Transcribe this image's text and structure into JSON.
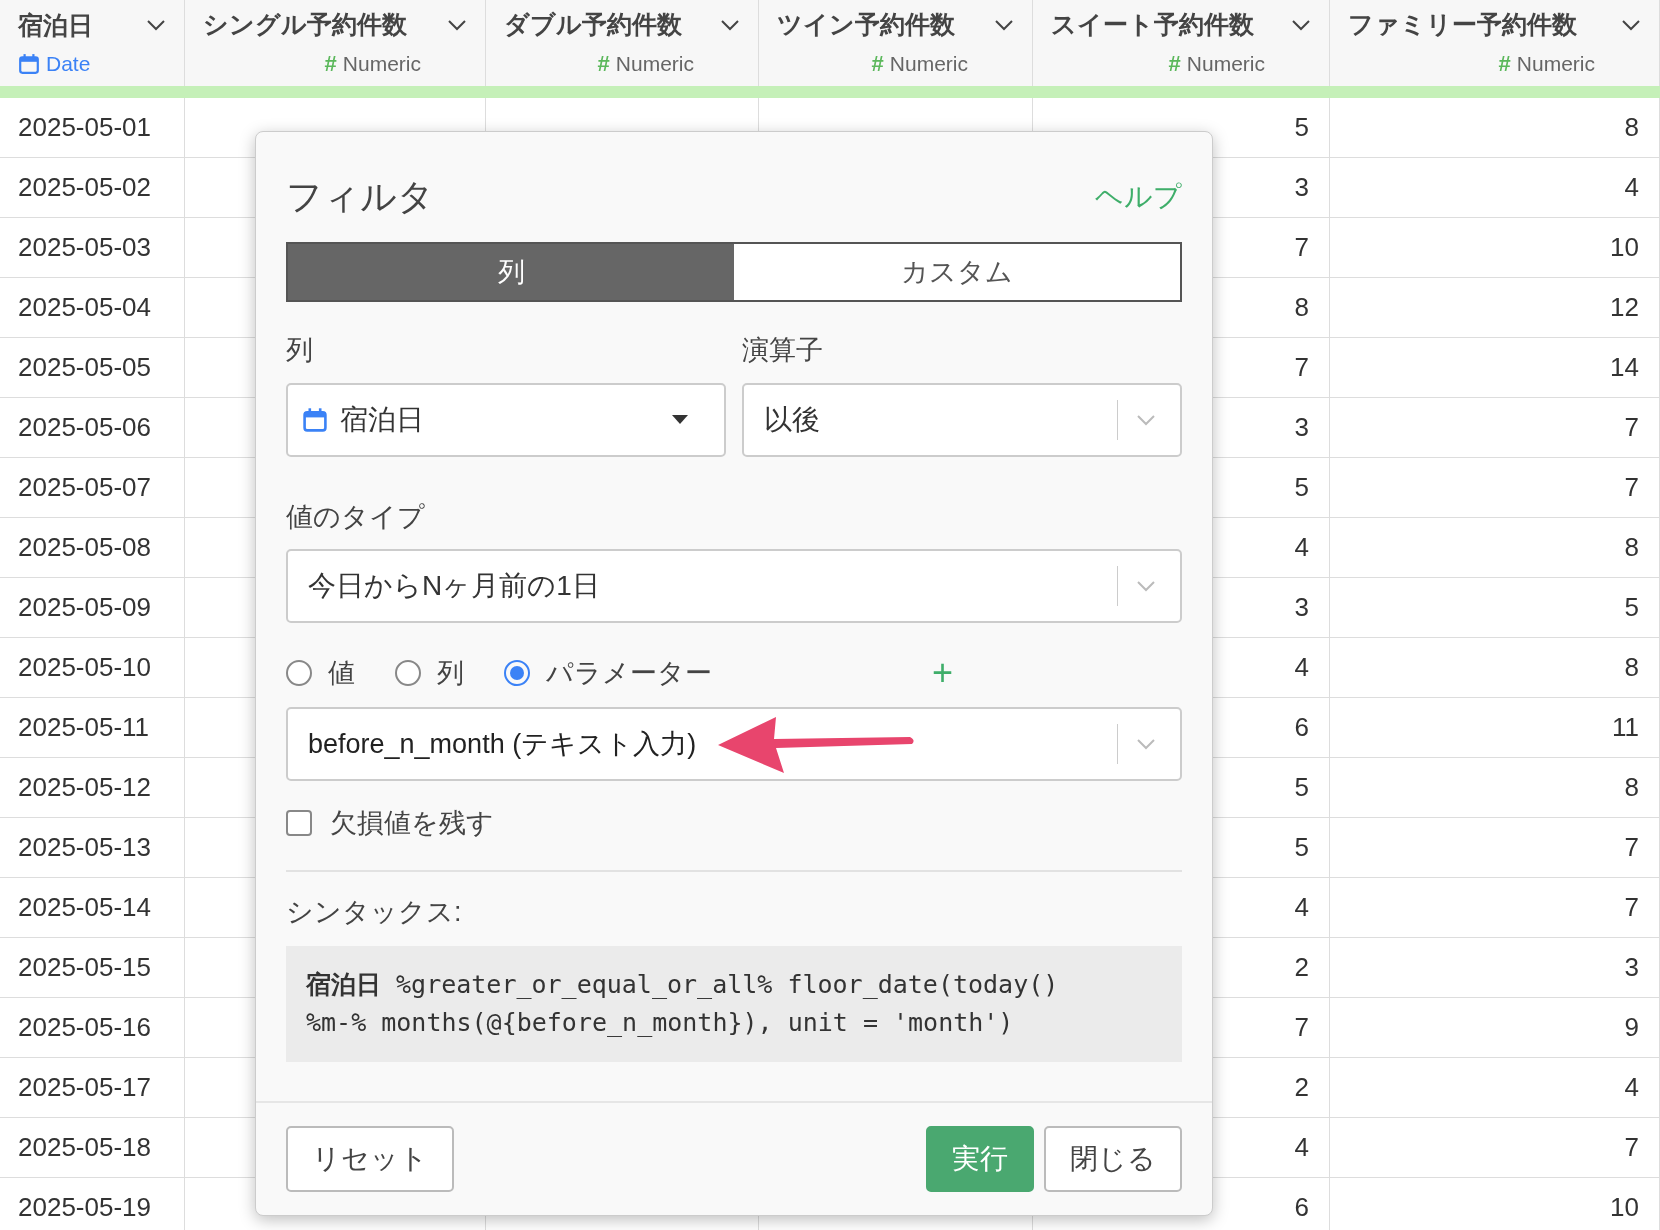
{
  "table": {
    "columns": [
      {
        "label": "宿泊日",
        "kind": "date",
        "type_label": "Date"
      },
      {
        "label": "シングル予約件数",
        "kind": "numeric",
        "type_icon": "#",
        "type_label": "Numeric"
      },
      {
        "label": "ダブル予約件数",
        "kind": "numeric",
        "type_icon": "#",
        "type_label": "Numeric"
      },
      {
        "label": "ツイン予約件数",
        "kind": "numeric",
        "type_icon": "#",
        "type_label": "Numeric"
      },
      {
        "label": "スイート予約件数",
        "kind": "numeric",
        "type_icon": "#",
        "type_label": "Numeric"
      },
      {
        "label": "ファミリー予約件数",
        "kind": "numeric",
        "type_icon": "#",
        "type_label": "Numeric"
      }
    ],
    "rows": [
      {
        "cells": [
          "2025-05-01",
          null,
          null,
          null,
          "5",
          "8"
        ]
      },
      {
        "cells": [
          "2025-05-02",
          null,
          null,
          null,
          "3",
          "4"
        ]
      },
      {
        "cells": [
          "2025-05-03",
          null,
          null,
          null,
          "7",
          "10"
        ]
      },
      {
        "cells": [
          "2025-05-04",
          null,
          null,
          null,
          "8",
          "12"
        ]
      },
      {
        "cells": [
          "2025-05-05",
          null,
          null,
          null,
          "7",
          "14"
        ]
      },
      {
        "cells": [
          "2025-05-06",
          null,
          null,
          null,
          "3",
          "7"
        ]
      },
      {
        "cells": [
          "2025-05-07",
          null,
          null,
          null,
          "5",
          "7"
        ]
      },
      {
        "cells": [
          "2025-05-08",
          null,
          null,
          null,
          "4",
          "8"
        ]
      },
      {
        "cells": [
          "2025-05-09",
          null,
          null,
          null,
          "3",
          "5"
        ]
      },
      {
        "cells": [
          "2025-05-10",
          null,
          null,
          null,
          "4",
          "8"
        ]
      },
      {
        "cells": [
          "2025-05-11",
          null,
          null,
          null,
          "6",
          "11"
        ]
      },
      {
        "cells": [
          "2025-05-12",
          null,
          null,
          null,
          "5",
          "8"
        ]
      },
      {
        "cells": [
          "2025-05-13",
          null,
          null,
          null,
          "5",
          "7"
        ]
      },
      {
        "cells": [
          "2025-05-14",
          null,
          null,
          null,
          "4",
          "7"
        ]
      },
      {
        "cells": [
          "2025-05-15",
          null,
          null,
          null,
          "2",
          "3"
        ]
      },
      {
        "cells": [
          "2025-05-16",
          null,
          null,
          null,
          "7",
          "9"
        ]
      },
      {
        "cells": [
          "2025-05-17",
          null,
          null,
          null,
          "2",
          "4"
        ]
      },
      {
        "cells": [
          "2025-05-18",
          null,
          null,
          null,
          "4",
          "7"
        ]
      },
      {
        "cells": [
          "2025-05-19",
          null,
          null,
          null,
          "6",
          "10"
        ]
      }
    ]
  },
  "dialog": {
    "title": "フィルタ",
    "help_link": "ヘルプ",
    "tabs": [
      {
        "label": "列",
        "selected": true
      },
      {
        "label": "カスタム",
        "selected": false
      }
    ],
    "column_field": {
      "label": "列",
      "value": "宿泊日"
    },
    "operator_field": {
      "label": "演算子",
      "value": "以後"
    },
    "value_type_field": {
      "label": "値のタイプ",
      "value": "今日からNヶ月前の1日"
    },
    "value_source": [
      {
        "label": "値",
        "selected": false
      },
      {
        "label": "列",
        "selected": false
      },
      {
        "label": "パラメーター",
        "selected": true
      }
    ],
    "add_button": "+",
    "parameter_field": {
      "value": "before_n_month (テキスト入力)"
    },
    "keep_missing": {
      "label": "欠損値を残す",
      "checked": false
    },
    "syntax": {
      "label": "シンタックス:",
      "code": "**宿泊日** %greater_or_equal_or_all% floor_date(today()\n%m-% months(@{before_n_month}), unit = 'month')"
    },
    "buttons": [
      {
        "label": "リセット",
        "kind": "default"
      },
      {
        "label": "実行",
        "kind": "primary"
      },
      {
        "label": "閉じる",
        "kind": "default"
      }
    ]
  }
}
